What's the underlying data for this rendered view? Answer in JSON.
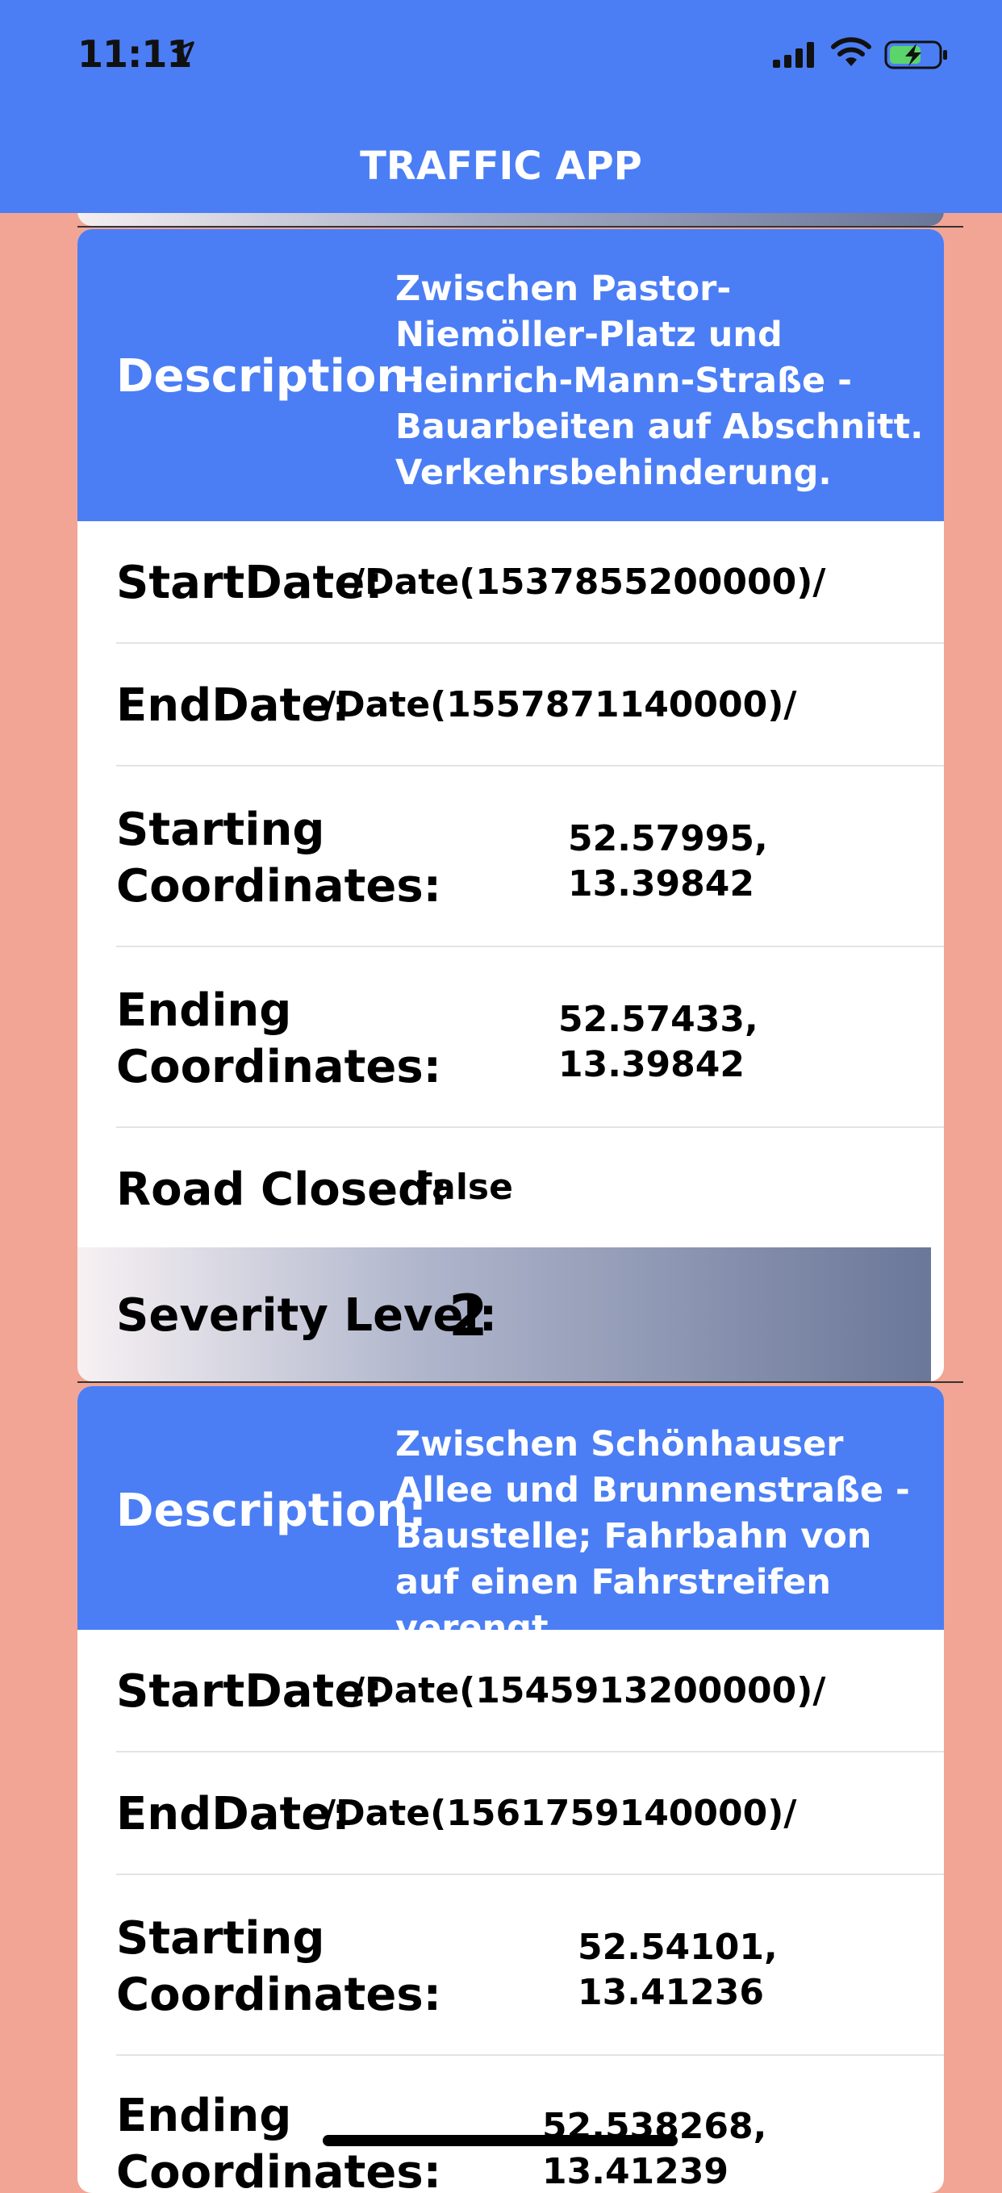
{
  "status_bar": {
    "time": "11:11",
    "icons": [
      "location-arrow-icon",
      "cellular-signal-icon",
      "wifi-icon",
      "battery-charging-icon"
    ]
  },
  "nav": {
    "title": "TRAFFIC APP"
  },
  "colors": {
    "header_blue": "#4B7EF5",
    "background_salmon": "#F2A594",
    "battery_green": "#5BD46A"
  },
  "labels": {
    "description": "Description:",
    "start_date": "StartDate:",
    "end_date": "EndDate:",
    "starting_coordinates": "Starting Coordinates:",
    "starting_line1": "Starting",
    "starting_line2": "Coordinates:",
    "ending_line1": "Ending",
    "ending_line2": "Coordinates:",
    "road_closed": "Road Closed:",
    "severity_level": "Severity Level:"
  },
  "items": [
    {
      "description": "Zwischen Pastor-Niemöller-Platz und Heinrich-Mann-Straße - Bauarbeiten auf Abschnitt. Verkehrsbehinderung.",
      "start_date": "/Date(1537855200000)/",
      "end_date": "/Date(1557871140000)/",
      "starting_coordinates_lat": "52.57995,",
      "starting_coordinates_lng": "13.39842",
      "ending_coordinates_lat": "52.57433,",
      "ending_coordinates_lng": "13.39842",
      "road_closed": "false",
      "severity_level": "2"
    },
    {
      "description": "Zwischen Schönhauser Allee und Brunnenstraße - Baustelle; Fahrbahn von auf einen Fahrstreifen verengt.",
      "start_date": "/Date(1545913200000)/",
      "end_date": "/Date(1561759140000)/",
      "starting_coordinates_lat": "52.54101,",
      "starting_coordinates_lng": "13.41236",
      "ending_coordinates_lat": "52.538268,",
      "ending_coordinates_lng": "13.41239"
    }
  ]
}
